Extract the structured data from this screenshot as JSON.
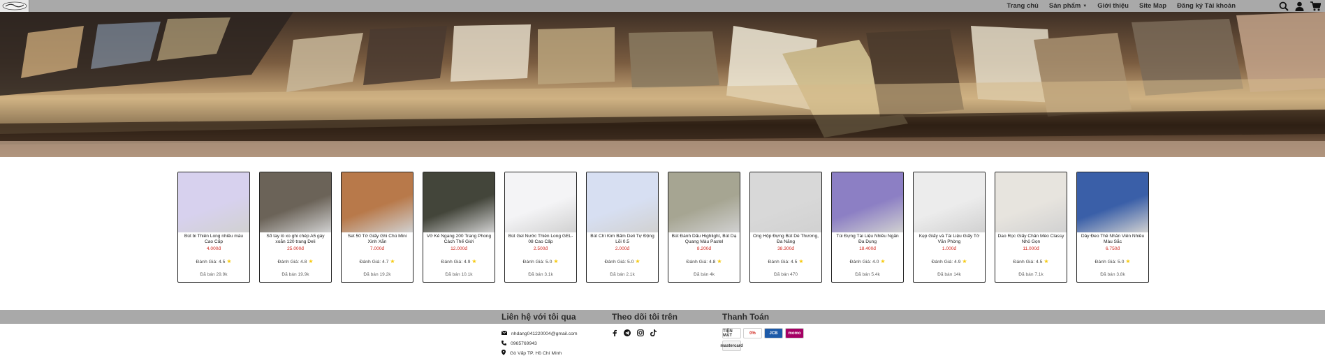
{
  "nav": {
    "logo_alt": "logo",
    "links": [
      "Trang chủ",
      "Sản phẩm",
      "Giới thiệu",
      "Site Map",
      "Đăng ký Tài khoản"
    ]
  },
  "products": [
    {
      "name": "Bút bi Thiên Long nhiều màu Cao Cấp",
      "price": "4.000đ",
      "rating": "Đánh Giá: 4.5",
      "sold": "Đã bán 29.9k",
      "thumb": "#d7d1ee"
    },
    {
      "name": "Sổ tay lò xo ghi chép A5 gáy xoắn 120 trang Deli",
      "price": "25.000đ",
      "rating": "Đánh Giá: 4.8",
      "sold": "Đã bán 19.9k",
      "thumb": "#6b6358"
    },
    {
      "name": "Set 50 Tờ Giấy Ghi Chú Mini Xinh Xắn",
      "price": "7.000đ",
      "rating": "Đánh Giá: 4.7",
      "sold": "Đã bán 19.2k",
      "thumb": "#b8794a"
    },
    {
      "name": "Vở Kẻ Ngang 200 Trang Phong Cách Thế Giới",
      "price": "12.000đ",
      "rating": "Đánh Giá: 4.9",
      "sold": "Đã bán 10.1k",
      "thumb": "#43453a"
    },
    {
      "name": "Bút Gel Nước Thiên Long GEL-08 Cao Cấp",
      "price": "2.500đ",
      "rating": "Đánh Giá: 5.0",
      "sold": "Đã bán 3.1k",
      "thumb": "#f4f4f6"
    },
    {
      "name": "Bút Chì Kim Bấm Deli Tự Động Lõi 0.5",
      "price": "2.000đ",
      "rating": "Đánh Giá: 5.0",
      "sold": "Đã bán 2.1k",
      "thumb": "#d7dff2"
    },
    {
      "name": "Bút Đánh Dấu Highlight, Bút Dạ Quang Màu Pastel",
      "price": "8.200đ",
      "rating": "Đánh Giá: 4.8",
      "sold": "Đã bán 4k",
      "thumb": "#a6a592"
    },
    {
      "name": "Ống Hộp Đựng Bút Dễ Thương, Đa Năng",
      "price": "38.300đ",
      "rating": "Đánh Giá: 4.5",
      "sold": "Đã bán 470",
      "thumb": "#d8d8d8"
    },
    {
      "name": "Túi Đựng Tài Liệu Nhiều Ngăn Đa Dụng",
      "price": "18.400đ",
      "rating": "Đánh Giá: 4.0",
      "sold": "Đã bán 5.4k",
      "thumb": "#8c7fc4"
    },
    {
      "name": "Kẹp Giấy và Tài Liệu Giấy Tờ Văn Phòng",
      "price": "1.000đ",
      "rating": "Đánh Giá: 4.9",
      "sold": "Đã bán 14k",
      "thumb": "#ececec"
    },
    {
      "name": "Dao Rọc Giấy Chân Mèo Classy Nhỏ Gọn",
      "price": "11.000đ",
      "rating": "Đánh Giá: 4.5",
      "sold": "Đã bán 7.1k",
      "thumb": "#e7e4de"
    },
    {
      "name": "Dây Đeo Thẻ Nhân Viên Nhiều Màu Sắc",
      "price": "6.750đ",
      "rating": "Đánh Giá: 5.0",
      "sold": "Đã bán 3.8k",
      "thumb": "#3a5fa8"
    }
  ],
  "footer": {
    "contact_title": "Liên hệ với tôi qua",
    "email": "nhdang041220004@gmail.com",
    "phone": "0965769943",
    "address": "Gò Vấp TP. Hồ Chí Minh",
    "follow_title": "Theo dõi tôi trên",
    "payment_title": "Thanh Toán",
    "payments": [
      {
        "label": "TIỀN MẶT",
        "color": "#ffffff",
        "text": "#333333"
      },
      {
        "label": "0%",
        "color": "#ffffff",
        "text": "#d0261d"
      },
      {
        "label": "JCB",
        "color": "#1d5aa8",
        "text": "#ffffff"
      },
      {
        "label": "momo",
        "color": "#a50064",
        "text": "#ffffff"
      },
      {
        "label": "mastercard",
        "color": "#f4f4f4",
        "text": "#333333"
      }
    ]
  }
}
